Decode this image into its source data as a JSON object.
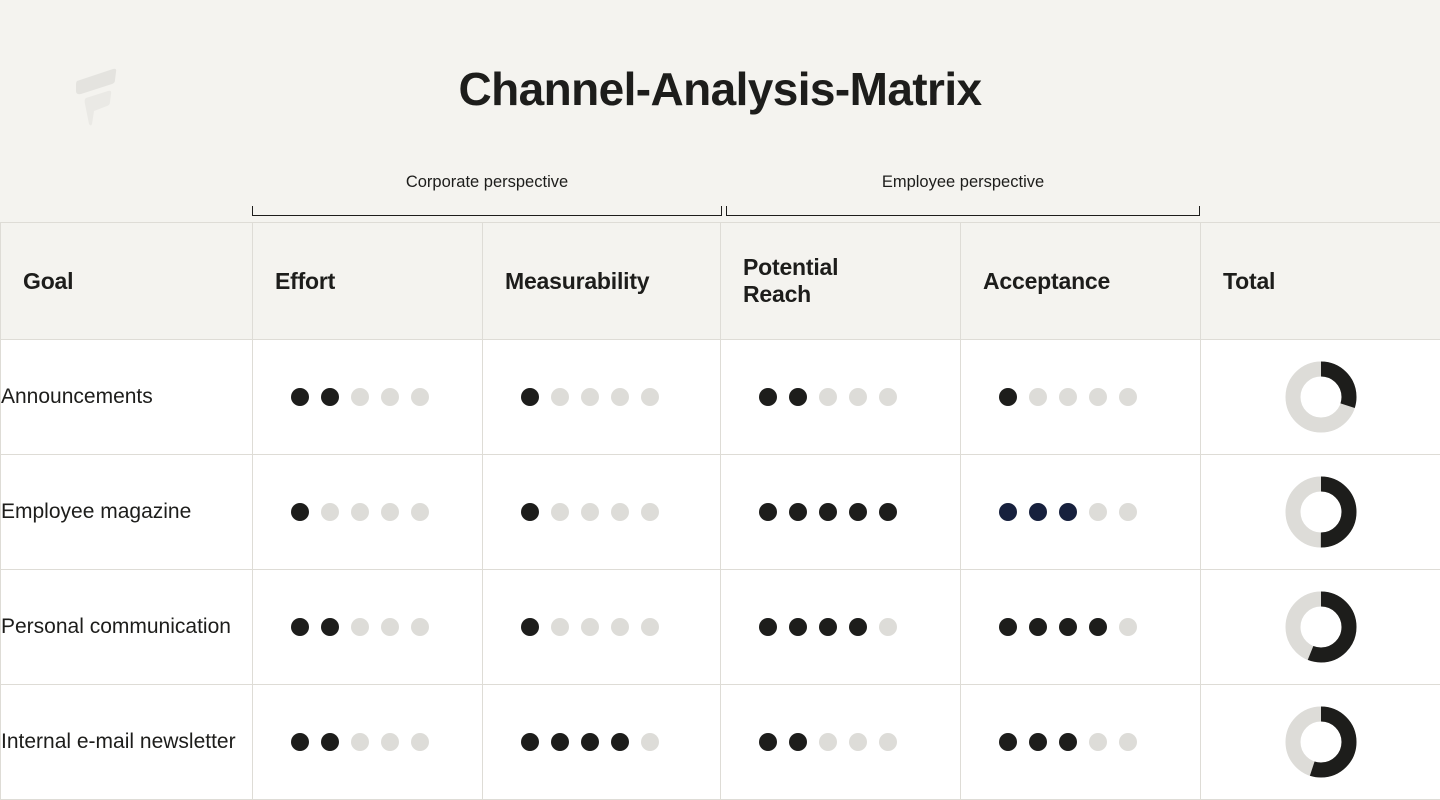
{
  "brand": {
    "logo_icon": "flipsnack-f-logo-icon",
    "logo_color": "#e2e1dd"
  },
  "header": {
    "title": "Channel-Analysis-Matrix"
  },
  "perspectives": [
    {
      "label": "Corporate perspective",
      "spans": [
        "Effort",
        "Measurability"
      ]
    },
    {
      "label": "Employee perspective",
      "spans": [
        "Potential Reach",
        "Acceptance"
      ]
    }
  ],
  "table": {
    "columns": [
      {
        "key": "goal",
        "label": "Goal"
      },
      {
        "key": "eff",
        "label": "Effort"
      },
      {
        "key": "meas",
        "label": "Measurability"
      },
      {
        "key": "reach",
        "label": "Potential\nReach"
      },
      {
        "key": "acc",
        "label": "Acceptance"
      },
      {
        "key": "total",
        "label": "Total"
      }
    ],
    "rows": [
      {
        "goal": "Announcements",
        "effort": 2,
        "measurability": 1,
        "potential_reach": 2,
        "acceptance": 1,
        "acceptance_color": "#1d1d1b",
        "total_percent": 30
      },
      {
        "goal": "Employee magazine",
        "effort": 1,
        "measurability": 1,
        "potential_reach": 5,
        "acceptance": 3,
        "acceptance_color": "#17203d",
        "total_percent": 50
      },
      {
        "goal": "Personal communication",
        "effort": 2,
        "measurability": 1,
        "potential_reach": 4,
        "acceptance": 4,
        "acceptance_color": "#1d1d1b",
        "total_percent": 56
      },
      {
        "goal": "Internal e-mail newsletter",
        "effort": 2,
        "measurability": 4,
        "potential_reach": 2,
        "acceptance": 3,
        "acceptance_color": "#1d1d1b",
        "total_percent": 55
      }
    ],
    "rating_scale_max": 5
  },
  "chart_data": {
    "type": "heatmap",
    "title": "Channel-Analysis-Matrix",
    "categories": [
      "Announcements",
      "Employee magazine",
      "Personal communication",
      "Internal e-mail newsletter"
    ],
    "series": [
      {
        "name": "Effort",
        "perspective": "Corporate perspective",
        "values": [
          2,
          1,
          2,
          2
        ],
        "max": 5
      },
      {
        "name": "Measurability",
        "perspective": "Corporate perspective",
        "values": [
          1,
          1,
          1,
          4
        ],
        "max": 5
      },
      {
        "name": "Potential Reach",
        "perspective": "Employee perspective",
        "values": [
          2,
          5,
          4,
          2
        ],
        "max": 5
      },
      {
        "name": "Acceptance",
        "perspective": "Employee perspective",
        "values": [
          1,
          3,
          4,
          3
        ],
        "max": 5
      },
      {
        "name": "Total",
        "perspective": "",
        "values": [
          30,
          50,
          56,
          55
        ],
        "unit": "%"
      }
    ],
    "xlabel": "",
    "ylabel": "",
    "legend": "",
    "colors": {
      "filled": "#1d1d1b",
      "empty": "#dddcd8",
      "accent": "#17203d",
      "background": "#f4f3ef"
    }
  }
}
